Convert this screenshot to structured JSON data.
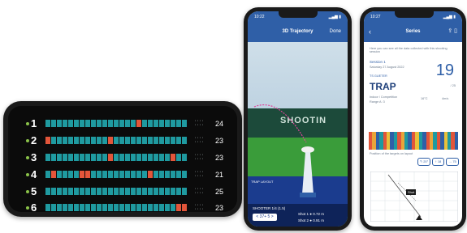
{
  "scoreboard": {
    "rounds": [
      {
        "index": "1",
        "total": "24",
        "misses": [
          17
        ]
      },
      {
        "index": "2",
        "total": "23",
        "misses": [
          1,
          12
        ]
      },
      {
        "index": "3",
        "total": "23",
        "misses": [
          12,
          23
        ]
      },
      {
        "index": "4",
        "total": "21",
        "misses": [
          2,
          7,
          8,
          19
        ]
      },
      {
        "index": "5",
        "total": "25",
        "misses": []
      },
      {
        "index": "6",
        "total": "23",
        "misses": [
          24,
          25
        ]
      }
    ],
    "targets_per_round": 25,
    "colors": {
      "hit": "#1f9aa0",
      "miss": "#e2553a",
      "index_dot": "#8bc34a"
    }
  },
  "trajectory_view": {
    "status_time": "10:22",
    "title": "3D Trajectory",
    "done_label": "Done",
    "banner": "SHOOTIN",
    "pad_label": "TRAP LAYOUT",
    "shooter_label": "SHOOTER 1/4 (1.5)",
    "selector_value": "< 37+ 5 >",
    "shot1": "Shot 1 ● 0.72 m",
    "shot2": "Shot 2 ● 0.91 m"
  },
  "series_view": {
    "status_time": "10:27",
    "back_icon": "‹",
    "title": "Series",
    "intro": "Here you can see all the data collected with this shooting session",
    "session_label": "Session 1",
    "session_date": "Saturday 27 August 2022",
    "location": "TS GUETER",
    "discipline": "TRAP",
    "score": "19",
    "score_max": "/ 25",
    "meta_1": "Indoor / Competition",
    "meta_2": "Range A: 3",
    "weather_1": "16°C",
    "weather_2": "4m/s",
    "strip_label": "Position of the targets on layout",
    "stat_left": "↰ 20°",
    "stat_mid": "↑ 18",
    "stat_right": "→ 75",
    "plot_marker": "Shot",
    "strip_colors": [
      "#e2553a",
      "#e8a53a",
      "#2f5fa7",
      "#1f9aa0",
      "#e2553a",
      "#e8c13a",
      "#2f5fa7",
      "#1f9aa0",
      "#e2553a",
      "#e8a53a",
      "#1f9aa0",
      "#2f5fa7",
      "#e2553a",
      "#e8c13a",
      "#1f9aa0",
      "#2f5fa7",
      "#e2553a",
      "#e8a53a",
      "#1f9aa0",
      "#e2553a",
      "#2f5fa7",
      "#e8c13a",
      "#1f9aa0",
      "#e2553a",
      "#2f5fa7"
    ]
  }
}
